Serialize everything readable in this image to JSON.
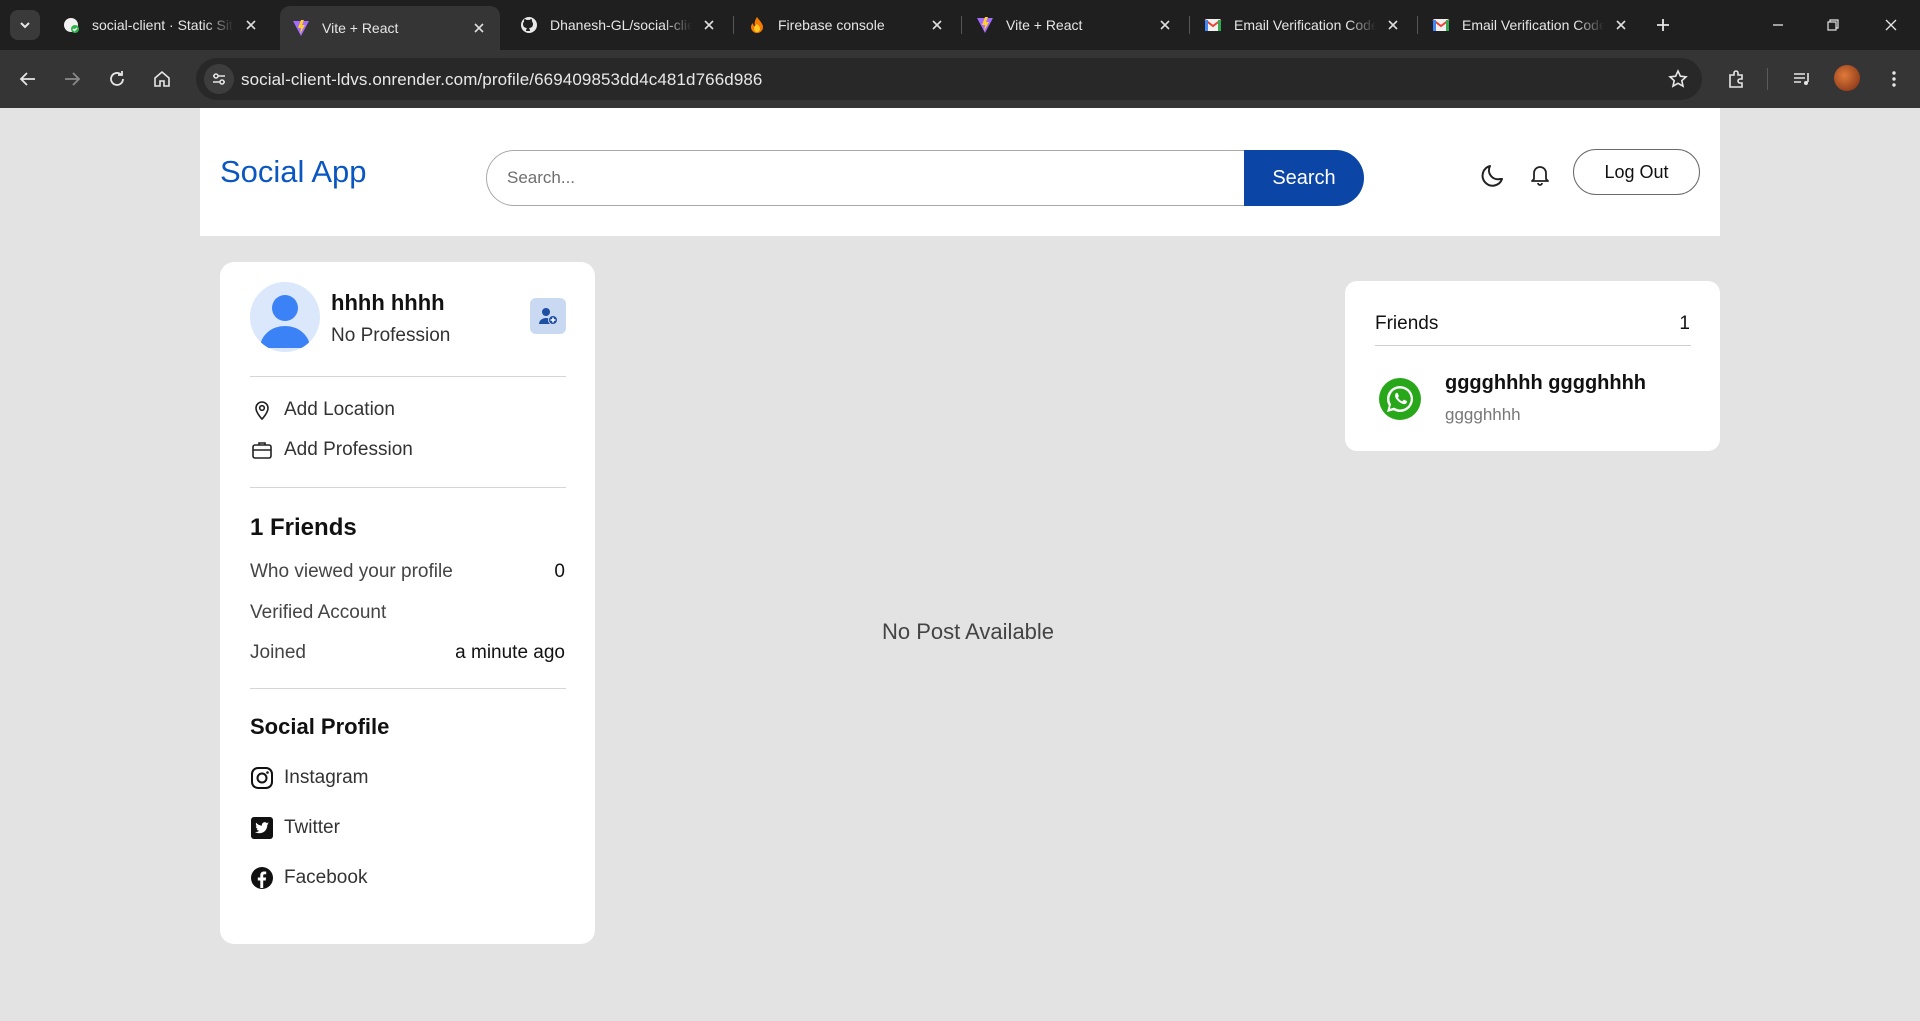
{
  "browser": {
    "tabs": [
      {
        "title": "social-client · Static Site",
        "icon": "render-icon"
      },
      {
        "title": "Vite + React",
        "icon": "vite-icon",
        "active": true
      },
      {
        "title": "Dhanesh-GL/social-client",
        "icon": "github-icon"
      },
      {
        "title": "Firebase console",
        "icon": "firebase-icon"
      },
      {
        "title": "Vite + React",
        "icon": "vite-icon"
      },
      {
        "title": "Email Verification Code",
        "icon": "gmail-icon"
      },
      {
        "title": "Email Verification Code",
        "icon": "gmail-icon"
      }
    ],
    "url": "social-client-ldvs.onrender.com/profile/669409853dd4c481d766d986"
  },
  "header": {
    "brand": "Social App",
    "search_placeholder": "Search...",
    "search_button": "Search",
    "logout_label": "Log Out"
  },
  "profile": {
    "name": "hhhh hhhh",
    "profession": "No Profession",
    "add_location": "Add Location",
    "add_profession": "Add Profession",
    "friends_heading": "1 Friends",
    "stats": {
      "viewed_label": "Who viewed your profile",
      "viewed_value": "0",
      "verified_label": "Verified Account",
      "joined_label": "Joined",
      "joined_value": "a minute ago"
    },
    "social_heading": "Social Profile",
    "social_links": {
      "instagram": "Instagram",
      "twitter": "Twitter",
      "facebook": "Facebook"
    }
  },
  "feed": {
    "empty_message": "No Post Available"
  },
  "friends_panel": {
    "title": "Friends",
    "count": "1",
    "friends": [
      {
        "name": "gggghhhh gggghhhh",
        "profession": "gggghhhh"
      }
    ]
  },
  "colors": {
    "brand": "#0a57c2",
    "search_button": "#0b45a5",
    "page_background": "#e3e3e3"
  }
}
